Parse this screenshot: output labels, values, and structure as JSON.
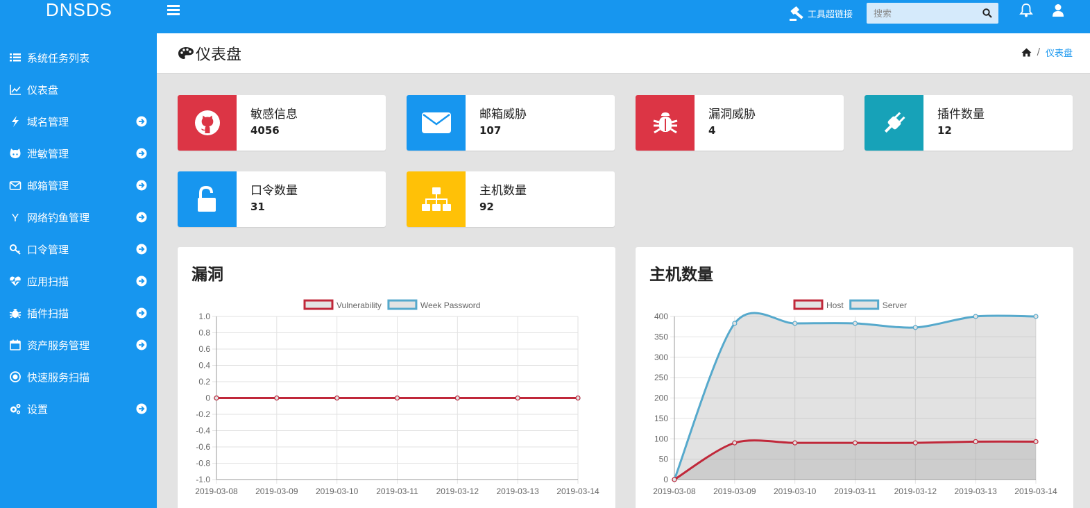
{
  "brand": "DNSDS",
  "topbar": {
    "tool_link": "工具超链接",
    "search_placeholder": "搜索"
  },
  "sidebar": {
    "items": [
      {
        "label": "系统任务列表",
        "icon": "list-icon",
        "has_arrow": false
      },
      {
        "label": "仪表盘",
        "icon": "line-chart-icon",
        "has_arrow": false
      },
      {
        "label": "域名管理",
        "icon": "bolt-icon",
        "has_arrow": true
      },
      {
        "label": "泄敏管理",
        "icon": "octocat-icon",
        "has_arrow": true
      },
      {
        "label": "邮箱管理",
        "icon": "envelope-icon",
        "has_arrow": true
      },
      {
        "label": "网络钓鱼管理",
        "icon": "hook-icon",
        "has_arrow": true
      },
      {
        "label": "口令管理",
        "icon": "key-icon",
        "has_arrow": true
      },
      {
        "label": "应用扫描",
        "icon": "heartbeat-icon",
        "has_arrow": true
      },
      {
        "label": "插件扫描",
        "icon": "bug-icon",
        "has_arrow": true
      },
      {
        "label": "资产服务管理",
        "icon": "calendar-icon",
        "has_arrow": true
      },
      {
        "label": "快速服务扫描",
        "icon": "dot-circle-icon",
        "has_arrow": false
      },
      {
        "label": "设置",
        "icon": "gears-icon",
        "has_arrow": true
      }
    ]
  },
  "header": {
    "title": "仪表盘",
    "breadcrumb_current": "仪表盘"
  },
  "info_boxes": [
    {
      "label": "敏感信息",
      "value": "4056",
      "icon": "github-icon",
      "color": "#dc3545"
    },
    {
      "label": "邮箱威胁",
      "value": "107",
      "icon": "envelope-icon",
      "color": "#1796ef"
    },
    {
      "label": "漏洞威胁",
      "value": "4",
      "icon": "bug-icon",
      "color": "#dc3545"
    },
    {
      "label": "插件数量",
      "value": "12",
      "icon": "plug-icon",
      "color": "#17a2b8"
    },
    {
      "label": "口令数量",
      "value": "31",
      "icon": "unlock-icon",
      "color": "#1796ef"
    },
    {
      "label": "主机数量",
      "value": "92",
      "icon": "sitemap-icon",
      "color": "#ffc107"
    }
  ],
  "colors": {
    "primary": "#1796ef",
    "danger": "#dc3545",
    "info": "#17a2b8",
    "warning": "#ffc107",
    "series_red": "#c0283a",
    "series_blue": "#56a9cc"
  },
  "chart_data": [
    {
      "type": "line",
      "title": "漏洞",
      "x": [
        "2019-03-08",
        "2019-03-09",
        "2019-03-10",
        "2019-03-11",
        "2019-03-12",
        "2019-03-13",
        "2019-03-14"
      ],
      "series": [
        {
          "name": "Vulnerability",
          "values": [
            0,
            0,
            0,
            0,
            0,
            0,
            0
          ]
        },
        {
          "name": "Week Password",
          "values": [
            0,
            0,
            0,
            0,
            0,
            0,
            0
          ]
        }
      ],
      "ylim": [
        -1.0,
        1.0
      ],
      "yticks": [
        "1.0",
        "0.8",
        "0.6",
        "0.4",
        "0.2",
        "0",
        "-0.2",
        "-0.4",
        "-0.6",
        "-0.8",
        "-1.0"
      ],
      "grid": true,
      "legend": "top-center"
    },
    {
      "type": "area",
      "title": "主机数量",
      "x": [
        "2019-03-08",
        "2019-03-09",
        "2019-03-10",
        "2019-03-11",
        "2019-03-12",
        "2019-03-13",
        "2019-03-14"
      ],
      "series": [
        {
          "name": "Host",
          "values": [
            0,
            90,
            90,
            90,
            90,
            93,
            93
          ]
        },
        {
          "name": "Server",
          "values": [
            0,
            383,
            383,
            383,
            373,
            400,
            400
          ]
        }
      ],
      "ylim": [
        0,
        400
      ],
      "yticks": [
        "400",
        "350",
        "300",
        "250",
        "200",
        "150",
        "100",
        "50",
        "0"
      ],
      "grid": true,
      "legend": "top-center"
    }
  ]
}
